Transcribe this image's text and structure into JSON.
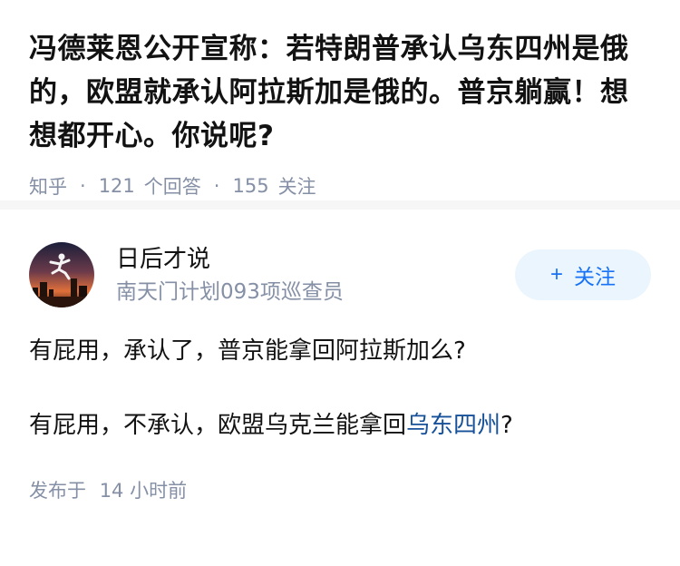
{
  "question": {
    "title": "冯德莱恩公开宣称：若特朗普承认乌东四州是俄的，欧盟就承认阿拉斯加是俄的。普京躺赢！想想都开心。你说呢?",
    "source": "知乎",
    "answer_count": "121",
    "answer_label": "个回答",
    "follow_count": "155",
    "follow_label": "关注"
  },
  "answer": {
    "author_name": "日后才说",
    "author_bio": "南天门计划093项巡查员",
    "follow_button": "关注",
    "follow_icon": "plus-icon",
    "paragraph1": "有屁用，承认了，普京能拿回阿拉斯加么?",
    "paragraph2_prefix": "有屁用，不承认，欧盟乌克兰能拿回",
    "paragraph2_link": "乌东四州",
    "paragraph2_suffix": "?",
    "publish_label": "发布于",
    "publish_time": "14 小时前"
  },
  "colors": {
    "accent": "#1772f6",
    "link": "#175199",
    "meta": "#8590a6",
    "button_bg": "#ebf5fd"
  }
}
